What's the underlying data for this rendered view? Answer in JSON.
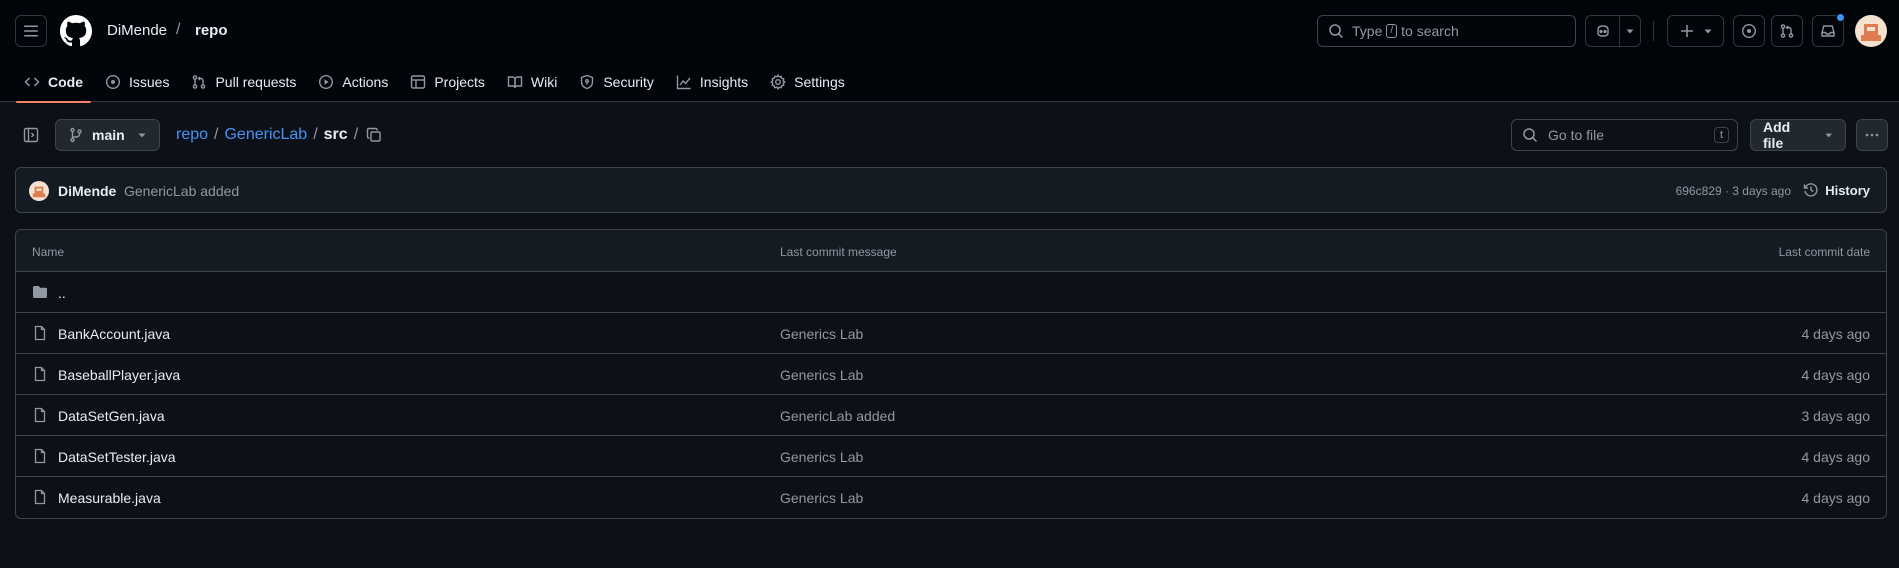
{
  "header": {
    "owner": "DiMende",
    "separator": "/",
    "repo": "repo",
    "search": {
      "prefix": "Type",
      "key": "/",
      "suffix": "to search"
    },
    "accent_color": "#f78166",
    "link_color": "#4493f8",
    "notification_dot_color": "#4493f8"
  },
  "tabs": [
    {
      "label": "Code",
      "icon": "code-icon",
      "active": true
    },
    {
      "label": "Issues",
      "icon": "issue-opened-icon"
    },
    {
      "label": "Pull requests",
      "icon": "git-pull-request-icon"
    },
    {
      "label": "Actions",
      "icon": "play-icon"
    },
    {
      "label": "Projects",
      "icon": "table-icon"
    },
    {
      "label": "Wiki",
      "icon": "book-icon"
    },
    {
      "label": "Security",
      "icon": "shield-icon"
    },
    {
      "label": "Insights",
      "icon": "graph-icon"
    },
    {
      "label": "Settings",
      "icon": "gear-icon"
    }
  ],
  "breadcrumb": {
    "branch": "main",
    "parts": [
      "repo",
      "GenericLab",
      "src"
    ],
    "sep": "/",
    "goto_placeholder": "Go to file",
    "goto_key": "t",
    "add_file": "Add file"
  },
  "commit": {
    "author": "DiMende",
    "message": "GenericLab added",
    "meta": "696c829 · 3 days ago",
    "history": "History"
  },
  "table": {
    "headers": {
      "name": "Name",
      "message": "Last commit message",
      "date": "Last commit date"
    },
    "parent": "..",
    "rows": [
      {
        "name": "BankAccount.java",
        "message": "Generics Lab",
        "date": "4 days ago"
      },
      {
        "name": "BaseballPlayer.java",
        "message": "Generics Lab",
        "date": "4 days ago"
      },
      {
        "name": "DataSetGen.java",
        "message": "GenericLab added",
        "date": "3 days ago"
      },
      {
        "name": "DataSetTester.java",
        "message": "Generics Lab",
        "date": "4 days ago"
      },
      {
        "name": "Measurable.java",
        "message": "Generics Lab",
        "date": "4 days ago"
      }
    ]
  }
}
